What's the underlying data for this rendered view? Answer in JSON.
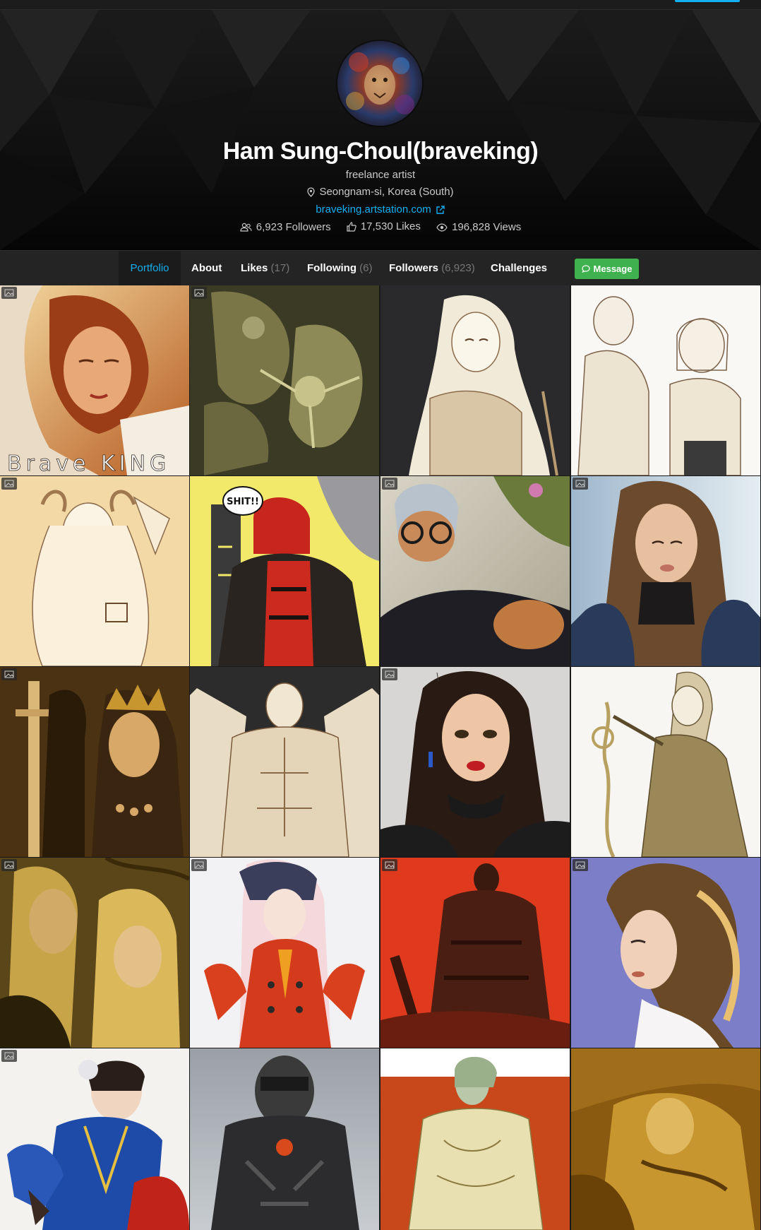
{
  "profile": {
    "name": "Ham Sung-Choul(braveking)",
    "headline": "freelance artist",
    "location": "Seongnam-si, Korea (South)",
    "website": "braveking.artstation.com"
  },
  "stats": {
    "followers": "6,923 Followers",
    "likes": "17,530 Likes",
    "views": "196,828 Views"
  },
  "nav": {
    "portfolio": "Portfolio",
    "about": "About",
    "likes": "Likes",
    "likes_count": "(17)",
    "following": "Following",
    "following_count": "(6)",
    "followers": "Followers",
    "followers_count": "(6,923)",
    "challenges": "Challenges",
    "message": "Message"
  },
  "artworks": [
    {
      "id": 1,
      "subject": "red-haired woman portrait",
      "watermark": "Brave KING",
      "multi_image": true
    },
    {
      "id": 2,
      "subject": "olive monochrome battle sketch",
      "multi_image": true
    },
    {
      "id": 3,
      "subject": "girl line art on dark background",
      "multi_image": false
    },
    {
      "id": 4,
      "subject": "couple sketch",
      "multi_image": false
    },
    {
      "id": 5,
      "subject": "horned girl sketch",
      "multi_image": true
    },
    {
      "id": 6,
      "subject": "hellboy",
      "speech_text": "SHIT!!",
      "multi_image": false
    },
    {
      "id": 7,
      "subject": "girl with glasses",
      "multi_image": true
    },
    {
      "id": 8,
      "subject": "woman in blue cape",
      "multi_image": true
    },
    {
      "id": 9,
      "subject": "queen with sword",
      "multi_image": true
    },
    {
      "id": 10,
      "subject": "armored man sketch",
      "multi_image": false
    },
    {
      "id": 11,
      "subject": "woman with choker",
      "multi_image": true
    },
    {
      "id": 12,
      "subject": "elf with staff",
      "multi_image": false
    },
    {
      "id": 13,
      "subject": "golden couple",
      "multi_image": true
    },
    {
      "id": 14,
      "subject": "pink-haired girl",
      "multi_image": true
    },
    {
      "id": 15,
      "subject": "dark knight on red",
      "multi_image": true
    },
    {
      "id": 16,
      "subject": "woman profile on violet",
      "multi_image": true
    },
    {
      "id": 17,
      "subject": "chun-li",
      "multi_image": true
    },
    {
      "id": 18,
      "subject": "masked soldier",
      "multi_image": false
    },
    {
      "id": 19,
      "subject": "armored elf on orange",
      "multi_image": false
    },
    {
      "id": 20,
      "subject": "golden reclining warrior",
      "multi_image": false
    }
  ],
  "colors": {
    "accent": "#13aff0",
    "message_button": "#3fb14e",
    "nav_background": "#242424"
  }
}
